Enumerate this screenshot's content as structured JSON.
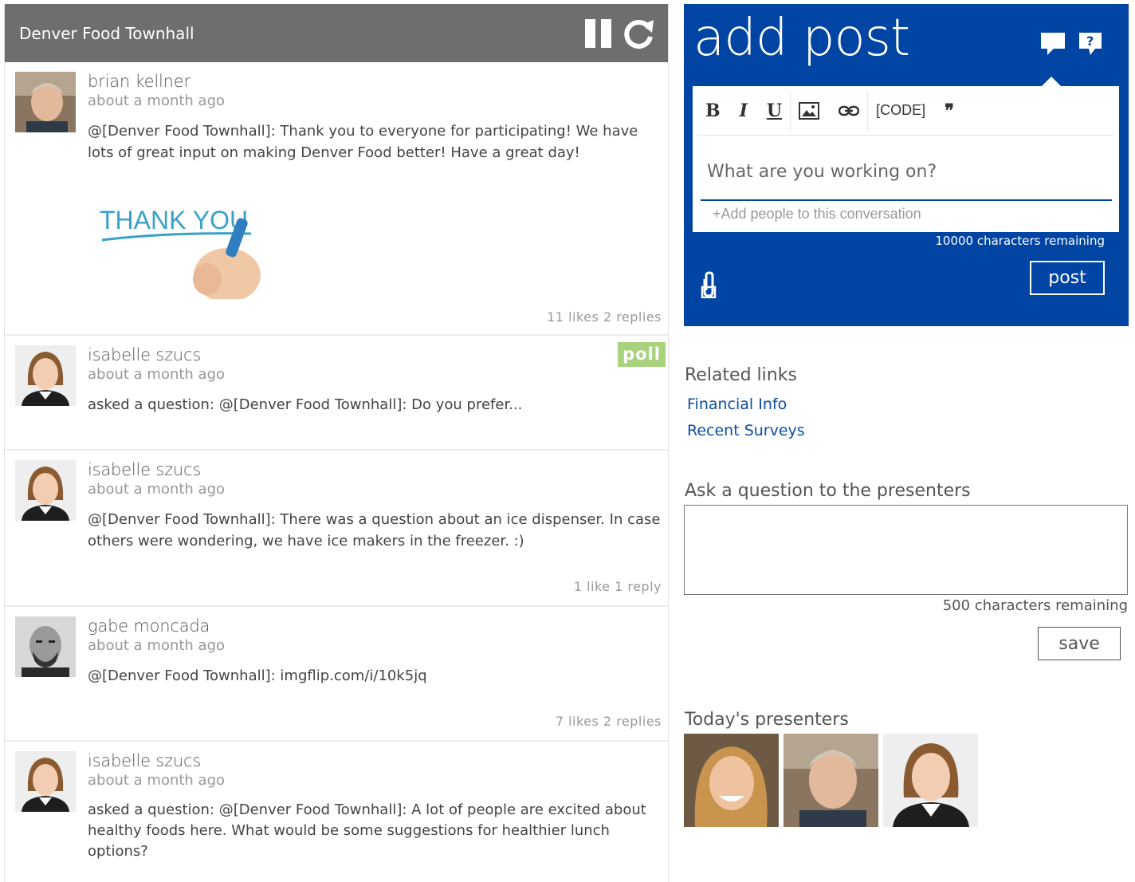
{
  "feed": {
    "title": "Denver Food Townhall",
    "posts": [
      {
        "author": "brian kellner",
        "time": "about a month ago",
        "body": "@[Denver Food Townhall]: Thank you to everyone for participating! We have lots of great input on making Denver Food better! Have a great day!",
        "image_text": "THANK YOU",
        "stats": "11 likes 2 replies"
      },
      {
        "author": "isabelle szucs",
        "time": "about a month ago",
        "badge": "poll",
        "body": "asked a question: @[Denver Food Townhall]: Do you prefer..."
      },
      {
        "author": "isabelle szucs",
        "time": "about a month ago",
        "body": "@[Denver Food Townhall]: There was a question about an ice dispenser. In case others were wondering, we have ice makers in the freezer. :)",
        "stats": "1 like 1 reply"
      },
      {
        "author": "gabe moncada",
        "time": "about a month ago",
        "body": "@[Denver Food Townhall]: imgflip.com/i/10k5jq",
        "stats": "7 likes 2 replies"
      },
      {
        "author": "isabelle szucs",
        "time": "about a month ago",
        "body": "asked a question: @[Denver Food Townhall]: A lot of people are excited about healthy foods here. What would be some suggestions for healthier lunch options?"
      }
    ]
  },
  "add_post": {
    "title": "add post",
    "toolbar": {
      "bold": "B",
      "italic": "I",
      "underline": "U",
      "code": "[CODE]",
      "quote": "❞"
    },
    "input_placeholder": "What are you working on?",
    "add_people": "+Add people to this conversation",
    "chars_remaining": "10000 characters remaining",
    "post_label": "post"
  },
  "related": {
    "title": "Related links",
    "links": [
      "Financial Info",
      "Recent Surveys"
    ]
  },
  "ask": {
    "title": "Ask a question to the presenters",
    "chars_remaining": "500 characters remaining",
    "save_label": "save"
  },
  "presenters": {
    "title": "Today's presenters"
  },
  "colors": {
    "header_bg": "#6e6e6e",
    "brand_blue": "#0044a4",
    "poll_green": "#a8d27c",
    "link_blue": "#0b4ea2"
  },
  "icons": [
    "pause-icon",
    "refresh-icon",
    "discussion-icon",
    "question-icon",
    "image-icon",
    "link-icon",
    "attach-icon"
  ]
}
